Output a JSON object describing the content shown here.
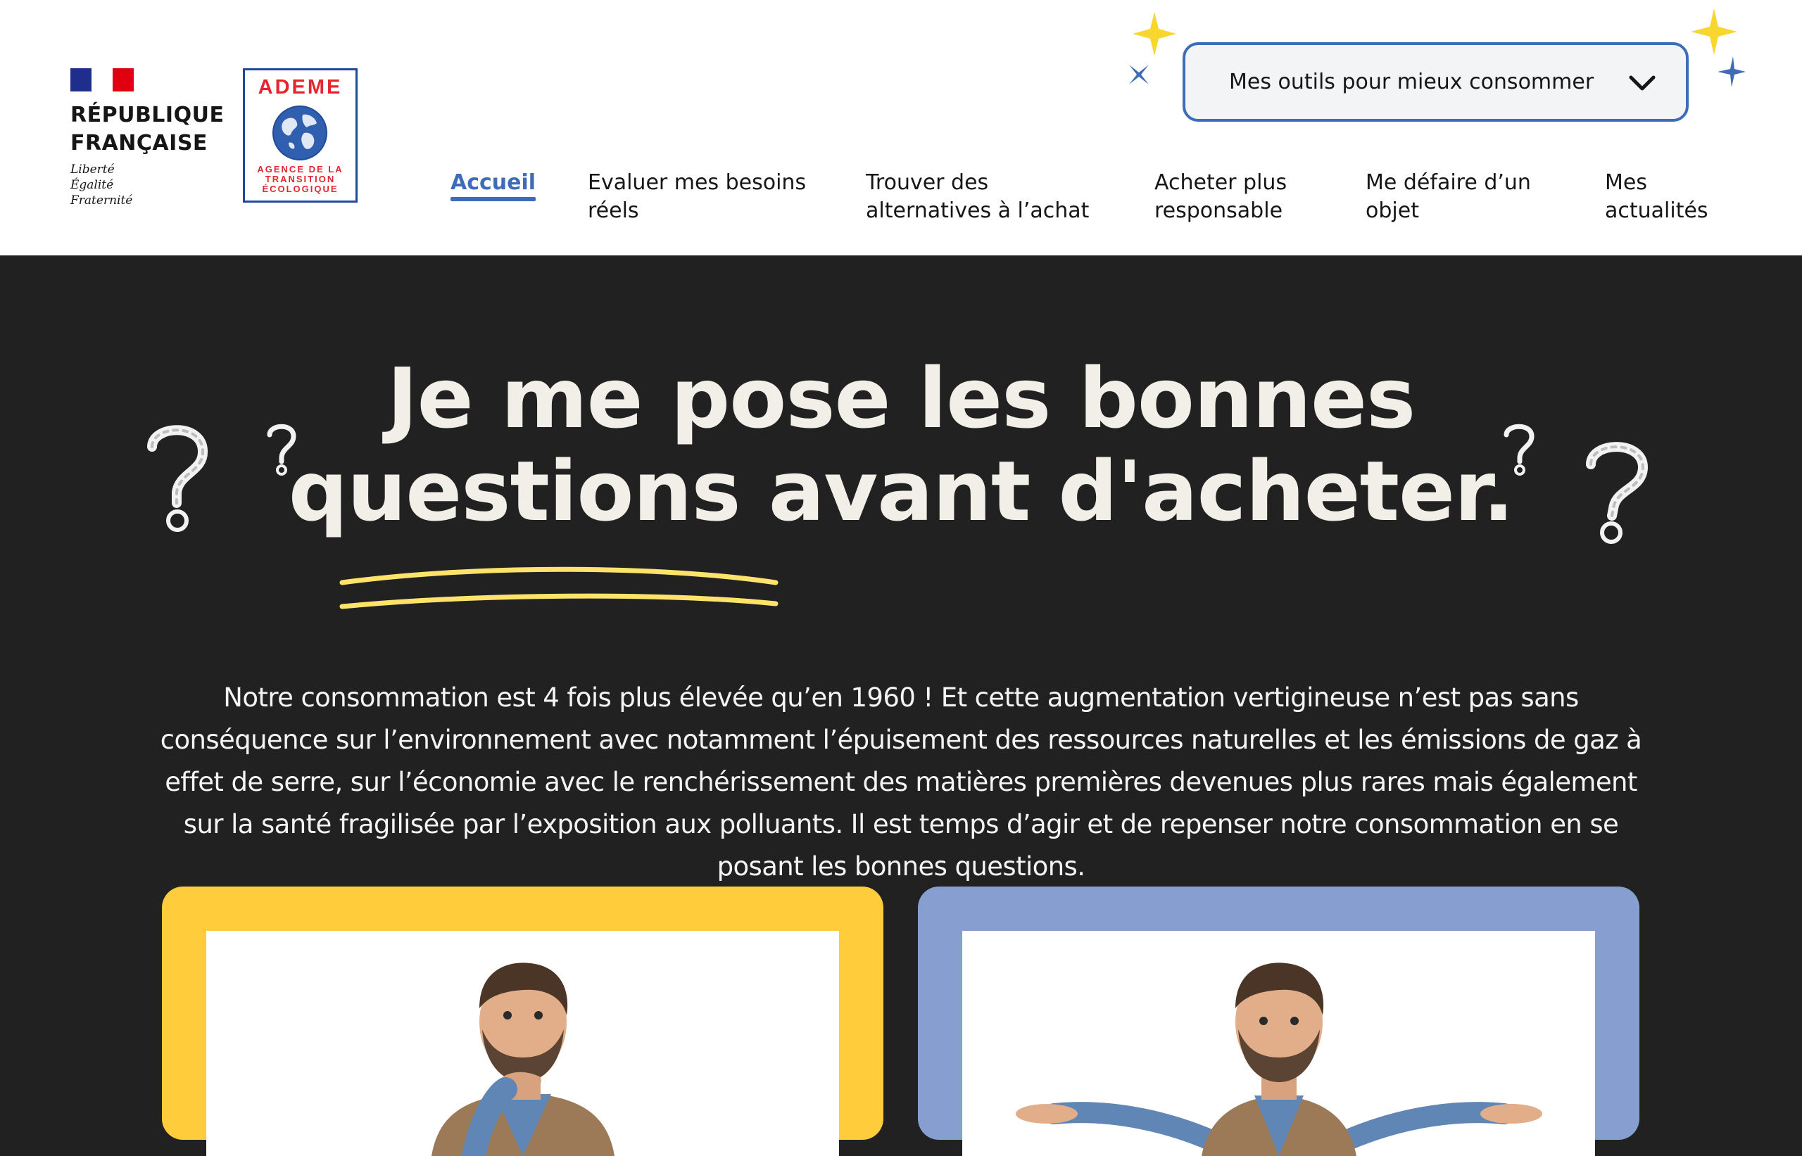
{
  "header": {
    "republique": {
      "name_line1": "RÉPUBLIQUE",
      "name_line2": "FRANÇAISE",
      "motto_line1": "Liberté",
      "motto_line2": "Égalité",
      "motto_line3": "Fraternité"
    },
    "ademe": {
      "title": "ADEME",
      "subtitle_line1": "AGENCE DE LA",
      "subtitle_line2": "TRANSITION",
      "subtitle_line3": "ÉCOLOGIQUE"
    },
    "tools_button": {
      "label": "Mes outils pour mieux consommer",
      "icon": "chevron-down-icon"
    },
    "nav": [
      {
        "label": "Accueil",
        "active": true
      },
      {
        "label": "Evaluer mes besoins\nréels",
        "active": false
      },
      {
        "label": "Trouver des\nalternatives à l’achat",
        "active": false
      },
      {
        "label": "Acheter plus\nresponsable",
        "active": false
      },
      {
        "label": "Me défaire d’un\nobjet",
        "active": false
      },
      {
        "label": "Mes\nactualités",
        "active": false
      }
    ]
  },
  "hero": {
    "title_line1": "Je me pose les bonnes",
    "title_line2": "questions avant d'acheter.",
    "intro": "Notre consommation est 4 fois plus élevée qu’en 1960 ! Et cette augmentation vertigineuse n’est pas sans conséquence sur l’environnement avec notamment l’épuisement des ressources naturelles et les émissions de gaz à effet de serre, sur l’économie avec le renchérissement des matières premières devenues plus rares mais également sur la santé fragilisée par l’exposition aux polluants. Il est temps d’agir et de repenser notre consommation en se posant les bonnes questions."
  },
  "cards": [
    {
      "color": "#ffcc3c",
      "image": "man-thinking"
    },
    {
      "color": "#879fd0",
      "image": "man-shrugging"
    }
  ],
  "colors": {
    "primary_blue": "#3f6cb8",
    "background_dark": "#212121",
    "accent_yellow": "#ffcc3c",
    "underline_yellow": "#fde36a",
    "star_yellow": "#f9d62e",
    "star_blue": "#3f6cb8"
  }
}
